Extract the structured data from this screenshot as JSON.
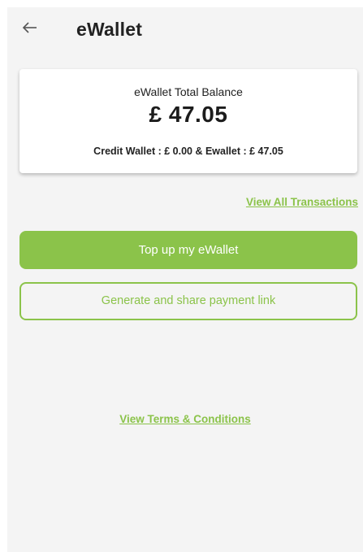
{
  "header": {
    "back_icon": "arrow-left-icon",
    "title": "eWallet"
  },
  "balance_card": {
    "label": "eWallet Total Balance",
    "amount": "£ 47.05",
    "breakdown": "Credit Wallet : £ 0.00 & Ewallet : £ 47.05"
  },
  "links": {
    "view_all_transactions": "View All Transactions",
    "view_terms": "View Terms & Conditions"
  },
  "buttons": {
    "top_up": "Top up my eWallet",
    "generate_link": "Generate and share payment link"
  },
  "colors": {
    "accent": "#8bc34a",
    "background": "#f4f4f4",
    "card": "#ffffff"
  }
}
